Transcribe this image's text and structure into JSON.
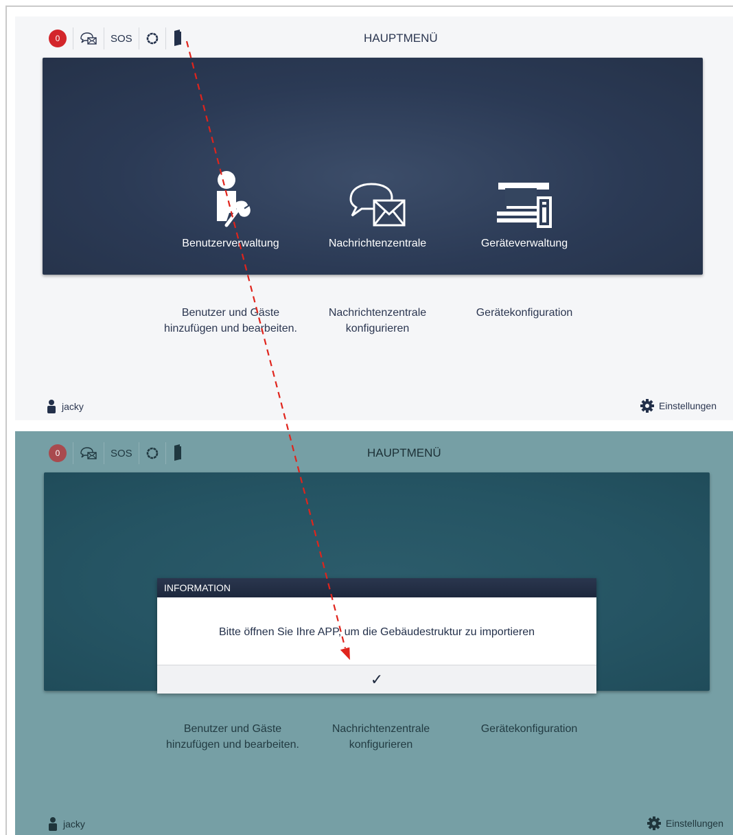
{
  "top": {
    "badge_count": "0",
    "sos_label": "SOS",
    "title": "HAUPTMENÜ",
    "tiles": [
      {
        "label": "Benutzerverwaltung",
        "icon": "user-wrench-icon"
      },
      {
        "label": "Nachrichtenzentrale",
        "icon": "message-envelope-icon"
      },
      {
        "label": "Geräteverwaltung",
        "icon": "device-management-icon"
      }
    ],
    "descriptions": [
      "Benutzer und Gäste hinzufügen und bearbeiten.",
      "Nachrichtenzentrale konfigurieren",
      "Gerätekonfiguration"
    ],
    "username": "jacky",
    "settings_label": "Einstellungen"
  },
  "bottom": {
    "badge_count": "0",
    "sos_label": "SOS",
    "title": "HAUPTMENÜ",
    "descriptions": [
      "Benutzer und Gäste hinzufügen und bearbeiten.",
      "Nachrichtenzentrale konfigurieren",
      "Gerätekonfiguration"
    ],
    "username": "jacky",
    "settings_label": "Einstellungen",
    "modal": {
      "title": "INFORMATION",
      "message": "Bitte öffnen Sie Ihre APP, um die Gebäudestruktur zu importieren",
      "confirm_label": "✓"
    }
  },
  "colors": {
    "accent_dark": "#2b3a55",
    "badge_red": "#d3262b",
    "overlay_teal": "#769fa5",
    "arrow_red": "#e0241c"
  }
}
